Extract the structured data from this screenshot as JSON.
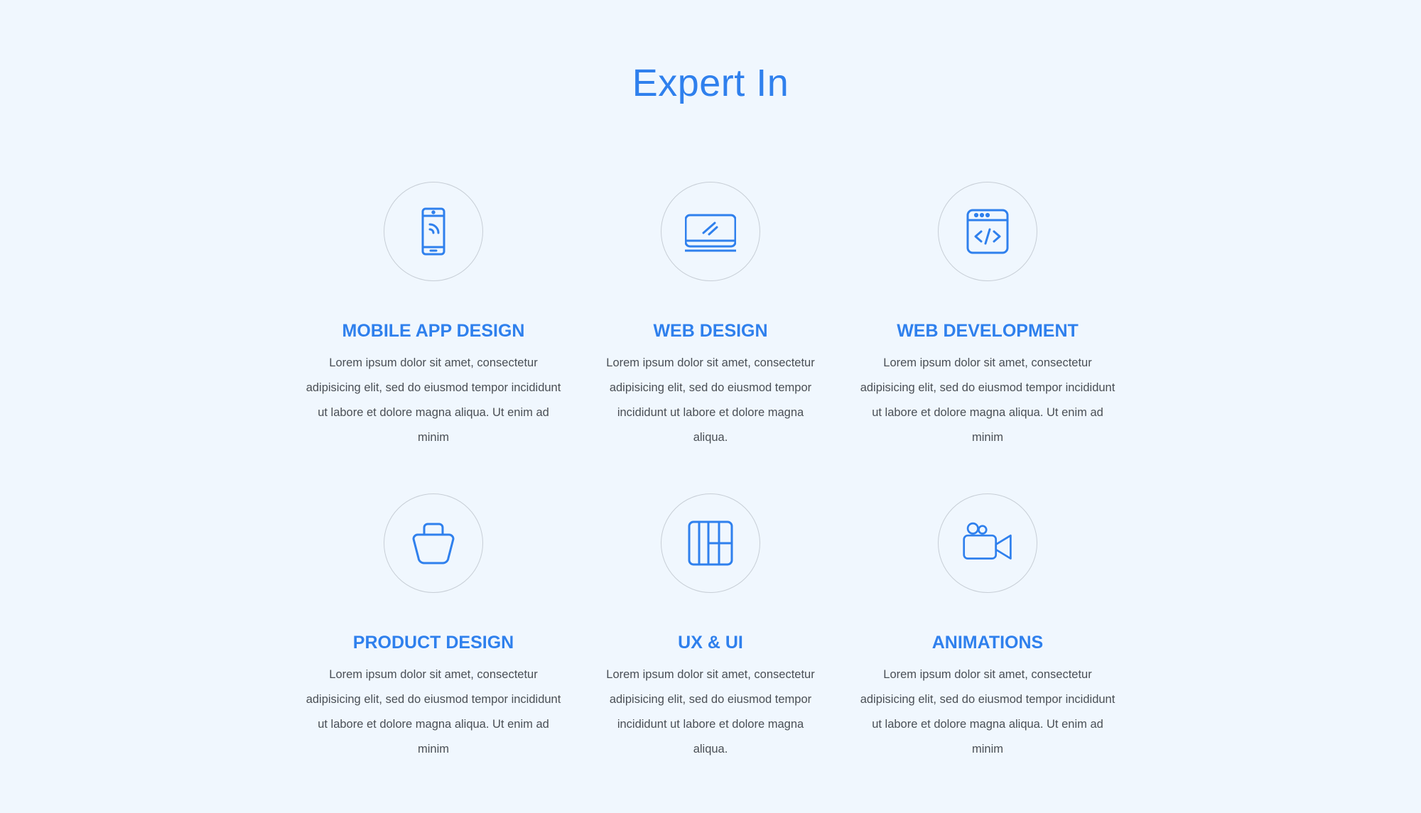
{
  "section": {
    "title": "Expert In"
  },
  "services": [
    {
      "title": "MOBILE APP DESIGN",
      "description": "Lorem ipsum dolor sit amet, consectetur adipisicing elit, sed do eiusmod tempor incididunt ut labore et dolore magna aliqua.  Ut enim ad minim",
      "icon": "mobile-phone-icon"
    },
    {
      "title": "WEB DESIGN",
      "description": "Lorem ipsum dolor sit amet, consectetur adipisicing elit, sed do eiusmod tempor incididunt ut labore et dolore magna aliqua.",
      "icon": "laptop-icon"
    },
    {
      "title": "WEB DEVELOPMENT",
      "description": "Lorem ipsum dolor sit amet, consectetur adipisicing elit, sed do eiusmod tempor incididunt ut labore et dolore magna aliqua.  Ut enim ad minim",
      "icon": "code-window-icon"
    },
    {
      "title": "PRODUCT DESIGN",
      "description": "Lorem ipsum dolor sit amet, consectetur adipisicing elit, sed do eiusmod tempor incididunt ut labore et dolore magna aliqua.  Ut enim ad minim",
      "icon": "bag-icon"
    },
    {
      "title": "UX & UI",
      "description": "Lorem ipsum dolor sit amet, consectetur adipisicing elit, sed do eiusmod tempor incididunt ut labore et dolore magna aliqua.",
      "icon": "grid-layout-icon"
    },
    {
      "title": "ANIMATIONS",
      "description": "Lorem ipsum dolor sit amet, consectetur adipisicing elit, sed do eiusmod tempor incididunt ut labore et dolore magna aliqua.  Ut enim ad minim",
      "icon": "video-camera-icon"
    }
  ],
  "colors": {
    "background": "#f0f7fe",
    "accent": "#2f80ed",
    "body_text": "#4a4f55",
    "circle_border": "#c7ced6"
  }
}
